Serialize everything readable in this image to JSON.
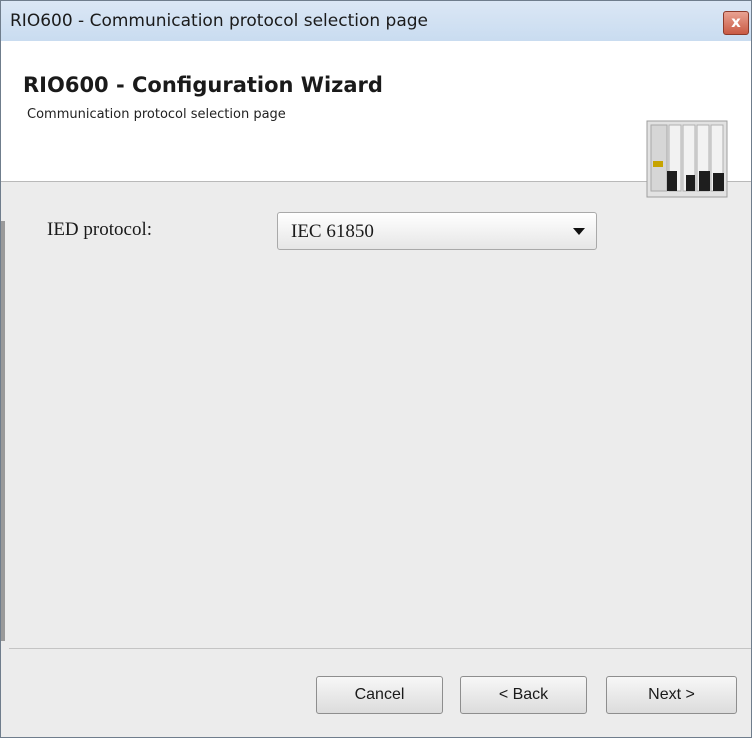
{
  "window": {
    "title": "RIO600 - Communication protocol selection page",
    "close_label": "x"
  },
  "header": {
    "title": "RIO600 - Configuration Wizard",
    "subtitle": "Communication protocol selection page",
    "image_icon": "device-module-icon"
  },
  "form": {
    "ied_protocol_label": "IED protocol:",
    "ied_protocol_value": "IEC 61850"
  },
  "buttons": {
    "cancel": "Cancel",
    "back": "< Back",
    "next": "Next >"
  },
  "colors": {
    "titlebar": "#c9dcf0",
    "close": "#c95a44",
    "background": "#ececec",
    "header_background": "#ffffff"
  }
}
